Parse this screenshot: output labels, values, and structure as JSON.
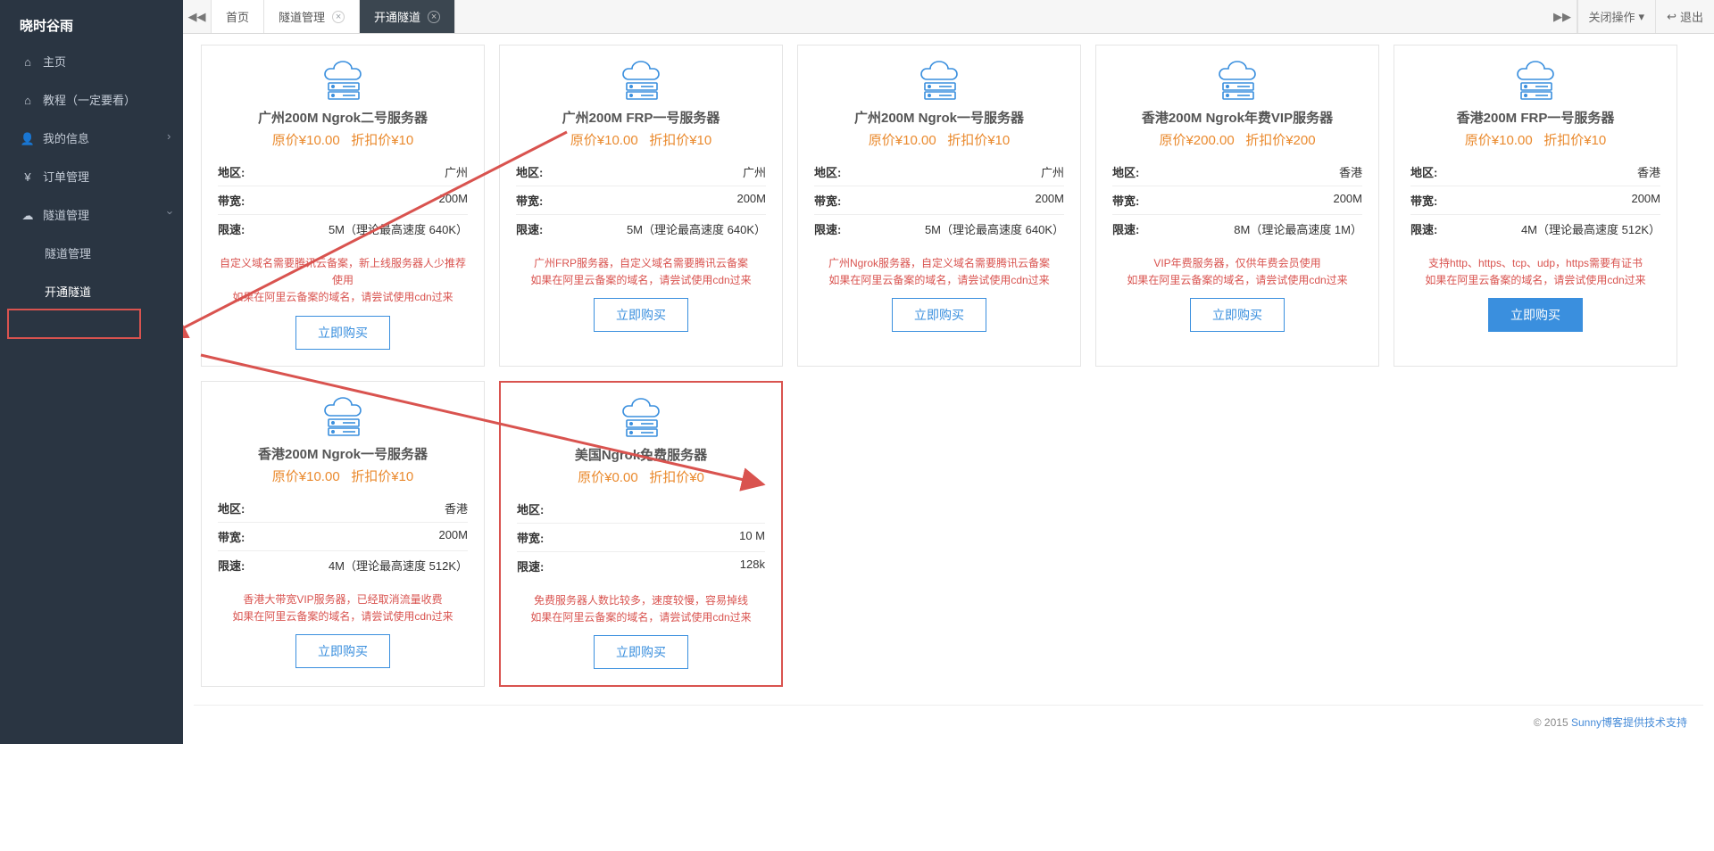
{
  "sidebar": {
    "brand": "晓时谷雨",
    "brand_sub": " ",
    "items": [
      {
        "icon": "⌂",
        "label": "主页"
      },
      {
        "icon": "⌂",
        "label": "教程（一定要看）"
      },
      {
        "icon": "👤",
        "label": "我的信息",
        "has_sub": true
      },
      {
        "icon": "¥",
        "label": "订单管理"
      },
      {
        "icon": "☁",
        "label": "隧道管理",
        "has_sub": true,
        "open": true,
        "sub": [
          {
            "label": "隧道管理"
          },
          {
            "label": "开通隧道",
            "active": true
          }
        ]
      }
    ]
  },
  "tabs": {
    "nav_left": "◀◀",
    "items": [
      {
        "label": "首页",
        "closable": false
      },
      {
        "label": "隧道管理",
        "closable": true
      },
      {
        "label": "开通隧道",
        "closable": true,
        "active": true
      }
    ],
    "nav_right": "▶▶",
    "close_ops": "关闭操作",
    "logout": "退出"
  },
  "labels": {
    "region": "地区:",
    "bandwidth": "带宽:",
    "speed": "限速:",
    "buy": "立即购买"
  },
  "footer": {
    "prefix": "© 2015 ",
    "link": "Sunny博客提供技术支持"
  },
  "cards": [
    {
      "title": "广州200M Ngrok二号服务器",
      "orig": "原价¥10.00",
      "disc": "折扣价¥10",
      "region": "广州",
      "bw": "200M",
      "speed": "5M（理论最高速度 640K）",
      "note1": "自定义域名需要腾讯云备案，新上线服务器人少推荐使用",
      "note2": "如果在阿里云备案的域名，请尝试使用cdn过来"
    },
    {
      "title": "广州200M FRP一号服务器",
      "orig": "原价¥10.00",
      "disc": "折扣价¥10",
      "region": "广州",
      "bw": "200M",
      "speed": "5M（理论最高速度 640K）",
      "note1": "广州FRP服务器，自定义域名需要腾讯云备案",
      "note2": "如果在阿里云备案的域名，请尝试使用cdn过来"
    },
    {
      "title": "广州200M Ngrok一号服务器",
      "orig": "原价¥10.00",
      "disc": "折扣价¥10",
      "region": "广州",
      "bw": "200M",
      "speed": "5M（理论最高速度 640K）",
      "note1": "广州Ngrok服务器，自定义域名需要腾讯云备案",
      "note2": "如果在阿里云备案的域名，请尝试使用cdn过来"
    },
    {
      "title": "香港200M Ngrok年费VIP服务器",
      "orig": "原价¥200.00",
      "disc": "折扣价¥200",
      "region": "香港",
      "bw": "200M",
      "speed": "8M（理论最高速度 1M）",
      "note1": "VIP年费服务器，仅供年费会员使用",
      "note2": "如果在阿里云备案的域名，请尝试使用cdn过来"
    },
    {
      "title": "香港200M FRP一号服务器",
      "orig": "原价¥10.00",
      "disc": "折扣价¥10",
      "region": "香港",
      "bw": "200M",
      "speed": "4M（理论最高速度 512K）",
      "note1": "支持http、https、tcp、udp，https需要有证书",
      "note2": "如果在阿里云备案的域名，请尝试使用cdn过来",
      "primary": true
    },
    {
      "title": "香港200M Ngrok一号服务器",
      "orig": "原价¥10.00",
      "disc": "折扣价¥10",
      "region": "香港",
      "bw": "200M",
      "speed": "4M（理论最高速度 512K）",
      "note1": "香港大带宽VIP服务器，已经取消流量收费",
      "note2": "如果在阿里云备案的域名，请尝试使用cdn过来"
    },
    {
      "title": "美国Ngrok免费服务器",
      "orig": "原价¥0.00",
      "disc": "折扣价¥0",
      "region": "",
      "bw": "10 M",
      "speed": "128k",
      "note1": "免费服务器人数比较多，速度较慢，容易掉线",
      "note2": "如果在阿里云备案的域名，请尝试使用cdn过来",
      "highlight": true
    }
  ]
}
